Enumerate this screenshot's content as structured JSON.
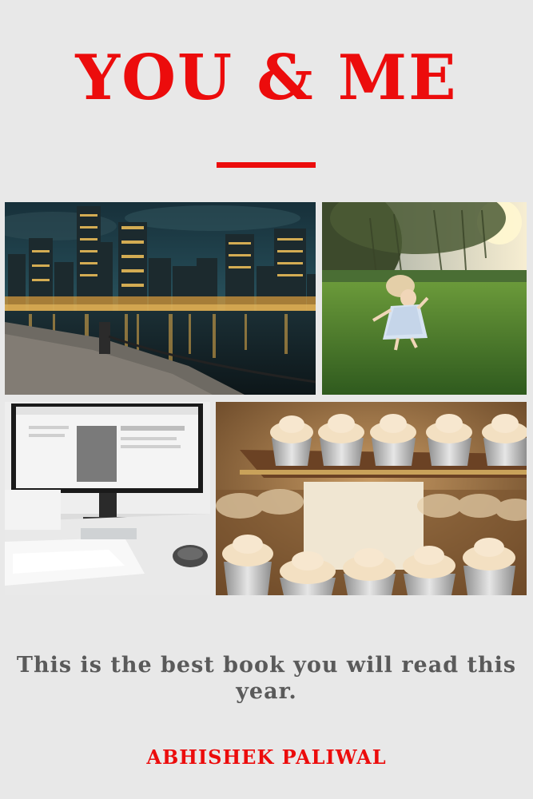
{
  "cover": {
    "title": "YOU & ME",
    "tagline": "This is the best book you will read this year.",
    "author": "ABHISHEK PALIWAL"
  },
  "colors": {
    "accent": "#ec0c0c",
    "background": "#e8e8e8",
    "tagline_text": "#5a5a5a"
  },
  "photos": [
    {
      "subject": "city-skyline-at-night"
    },
    {
      "subject": "girl-dancing-in-park"
    },
    {
      "subject": "computer-monitor-on-desk"
    },
    {
      "subject": "cupcakes-on-tiered-stand"
    }
  ]
}
